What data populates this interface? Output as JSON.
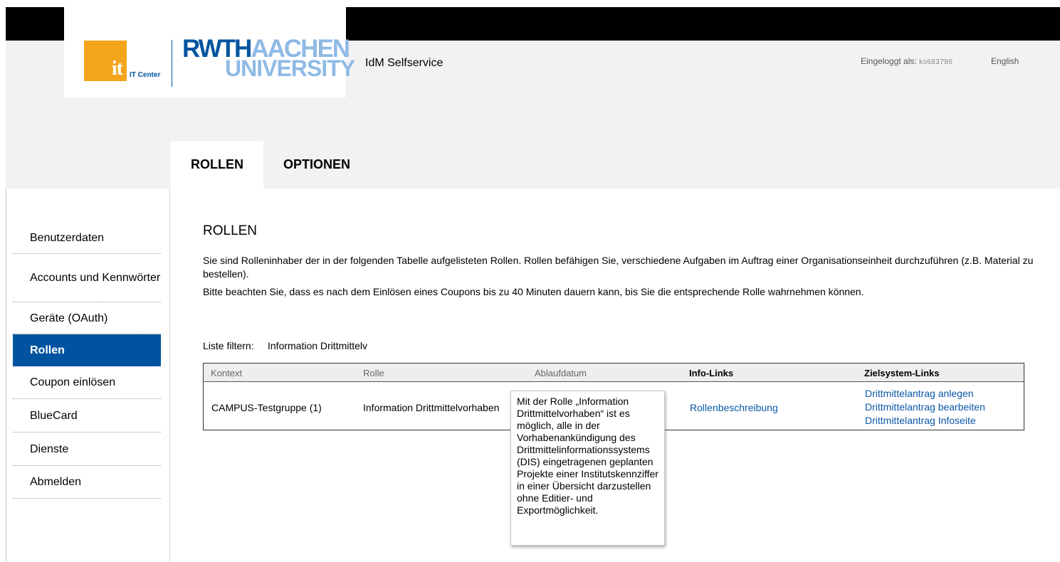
{
  "header": {
    "it_logo_text": "it",
    "it_center_label": "IT Center",
    "rwth_dark": "RWTH",
    "rwth_light": "AACHEN",
    "rwth_university": "UNIVERSITY",
    "app_title": "IdM Selfservice",
    "login_label": "Eingeloggt als:",
    "login_user": "ks683786",
    "language_link": "English",
    "brand_color": "#00549f",
    "it_color": "#f4a51c"
  },
  "tabs": [
    {
      "label": "ROLLEN",
      "active": true
    },
    {
      "label": "OPTIONEN",
      "active": false
    }
  ],
  "sidebar": {
    "items": [
      {
        "label": "Benutzerdaten"
      },
      {
        "label": "Accounts und Kennwörter"
      },
      {
        "label": "Geräte (OAuth)"
      },
      {
        "label": "Rollen",
        "active": true
      },
      {
        "label": "Coupon einlösen"
      },
      {
        "label": "BlueCard"
      },
      {
        "label": "Dienste"
      },
      {
        "label": "Abmelden"
      }
    ]
  },
  "main": {
    "title": "ROLLEN",
    "description_1": "Sie sind Rolleninhaber der in der folgenden Tabelle aufgelisteten Rollen. Rollen befähigen Sie, verschiedene Aufgaben im Auftrag einer Organisationseinheit durchzuführen (z.B. Material zu bestellen).",
    "description_2": "Bitte beachten Sie, dass es nach dem Einlösen eines Coupons bis zu 40 Minuten dauern kann, bis Sie die entsprechende Rolle wahrnehmen können.",
    "filter_label": "Liste filtern:",
    "filter_value": "Information Drittmittelv"
  },
  "table": {
    "headers": [
      "Kontext",
      "Rolle",
      "Ablaufdatum",
      "Info-Links",
      "Zielsystem-Links"
    ],
    "rows": [
      {
        "kontext": "CAMPUS-Testgruppe (1)",
        "rolle": "Information Drittmittelvorhaben",
        "ablaufdatum": "",
        "info_link": "Rollenbeschreibung",
        "ziel_links": [
          "Drittmittelantrag anlegen",
          "Drittmittelantrag bearbeiten",
          "Drittmittelantrag Infoseite"
        ]
      }
    ]
  },
  "tooltip": {
    "text": "Mit der Rolle „Information Drittmittelvorhaben“ ist es möglich, alle in der Vorhabenankündigung des Drittmittelinformationssystems (DIS) eingetragenen geplanten Projekte einer Institutskennziffer in einer Übersicht darzustellen ohne Editier- und Exportmöglichkeit."
  }
}
